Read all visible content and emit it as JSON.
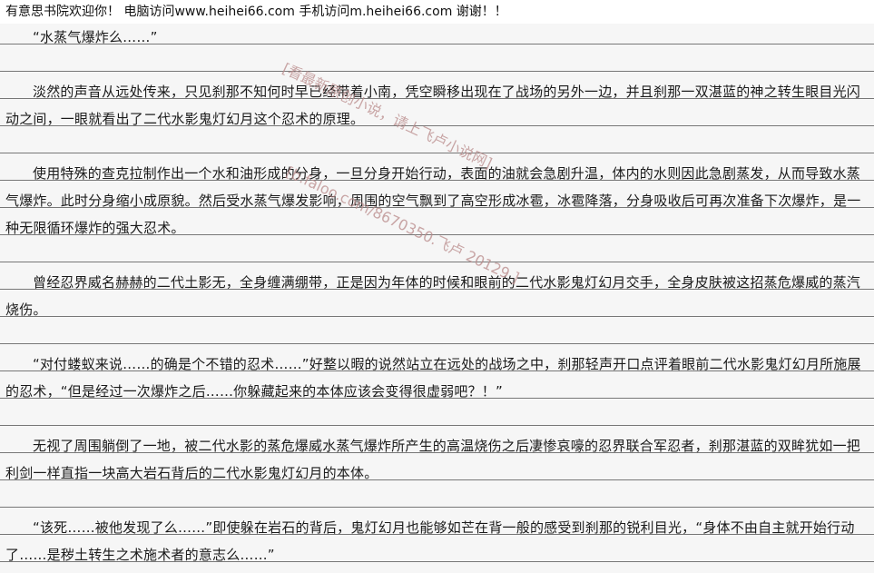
{
  "header": {
    "text": "有意思书院欢迎你！  电脑访问www.heihei66.com    手机访问m.heihei66.com  谢谢！！"
  },
  "watermarks": {
    "line1": "[看最新原创小说，请上飞卢小说网]",
    "line2": "[b.faloo.com/8670350.飞卢 20129 ]"
  },
  "paragraphs": [
    "“水蒸气爆炸么……”",
    "淡然的声音从远处传来，只见刹那不知何时早已经带着小南，凭空瞬移出现在了战场的另外一边，并且刹那一双湛蓝的神之转生眼目光闪动之间，一眼就看出了二代水影鬼灯幻月这个忍术的原理。",
    "使用特殊的查克拉制作出一个水和油形成的分身，一旦分身开始行动，表面的油就会急剧升温，体内的水则因此急剧蒸发，从而导致水蒸气爆炸。此时分身缩小成原貌。然后受水蒸气爆发影响，周围的空气飘到了高空形成冰雹，冰雹降落，分身吸收后可再次准备下次爆炸，是一种无限循环爆炸的强大忍术。",
    "曾经忍界威名赫赫的二代土影无，全身缠满绷带，正是因为年体的时候和眼前的二代水影鬼灯幻月交手，全身皮肤被这招蒸危爆威的蒸汽烧伤。",
    "“对付蝼蚁来说……的确是个不错的忍术……”好整以暇的说然站立在远处的战场之中，刹那轻声开口点评着眼前二代水影鬼灯幻月所施展的忍术，“但是经过一次爆炸之后……你躲藏起来的本体应该会变得很虚弱吧？！”",
    "无视了周围躺倒了一地，被二代水影的蒸危爆威水蒸气爆炸所产生的高温烧伤之后凄惨哀嚎的忍界联合军忍者，刹那湛蓝的双眸犹如一把利剑一样直指一块高大岩石背后的二代水影鬼灯幻月的本体。",
    "“该死……被他发现了么……”即使躲在岩石的背后，鬼灯幻月也能够如芒在背一般的感受到刹那的锐利目光，“身体不由自主就开始行动了……是秽土转生之术施术者的意志么……”"
  ]
}
